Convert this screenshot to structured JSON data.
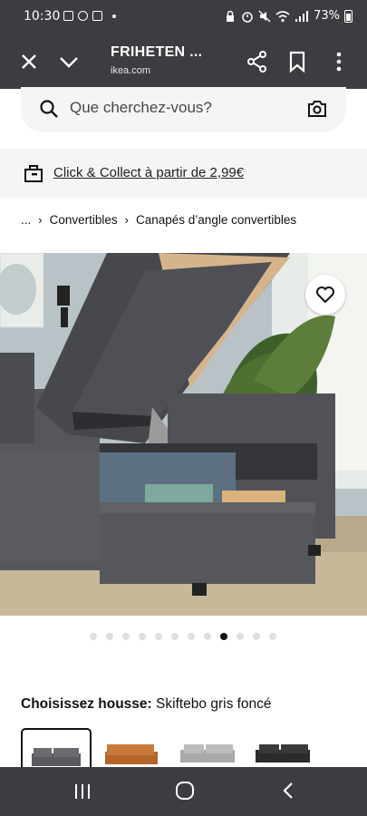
{
  "status_bar": {
    "time": "10:30",
    "battery": "73%"
  },
  "toolbar": {
    "title": "FRIHETEN ...",
    "domain": "ikea.com"
  },
  "search": {
    "placeholder": "Que cherchez-vous?"
  },
  "collect": {
    "link_text": "Click & Collect à partir de 2,99€"
  },
  "breadcrumb": {
    "items": [
      "...",
      "Convertibles",
      "Canapés d’angle convertibles"
    ],
    "separator": "›"
  },
  "gallery": {
    "image_count": 12,
    "active_index": 8
  },
  "cover": {
    "label": "Choisissez housse:",
    "selected_value": "Skiftebo gris foncé",
    "options": [
      "dark-grey",
      "orange-brown",
      "light-grey",
      "black"
    ]
  },
  "colors": {
    "chrome": "#3c3d40",
    "surface": "#f5f5f5",
    "text": "#111111"
  }
}
